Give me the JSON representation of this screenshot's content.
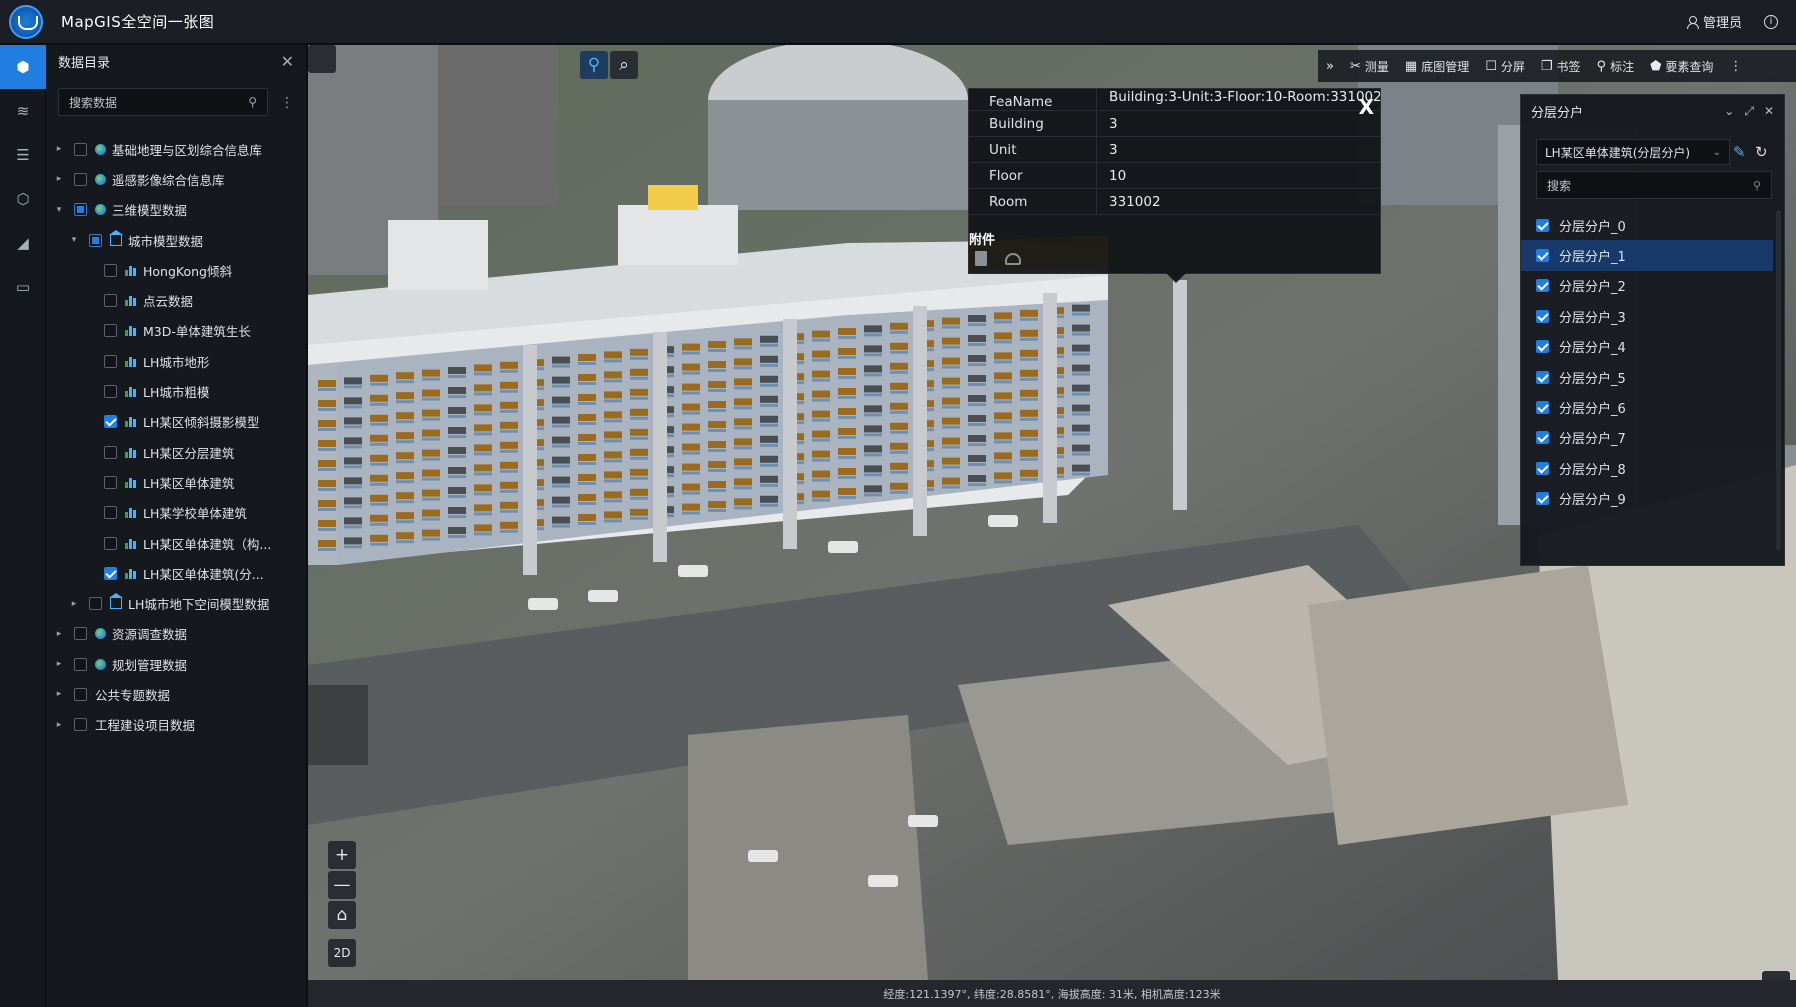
{
  "app": {
    "title": "MapGIS全空间一张图",
    "user": "管理员"
  },
  "leftbar": {
    "items": [
      "cube-icon",
      "layers-icon",
      "list-icon",
      "shield-icon",
      "draw-icon",
      "screen-icon"
    ]
  },
  "catalog": {
    "title": "数据目录",
    "search_placeholder": "搜索数据",
    "nodes": [
      {
        "label": "基础地理与区划综合信息库",
        "arrow": "▸",
        "check": "none",
        "icon": "globe"
      },
      {
        "label": "遥感影像综合信息库",
        "arrow": "▸",
        "check": "none",
        "icon": "globe"
      },
      {
        "label": "三维模型数据",
        "arrow": "▾",
        "check": "partial",
        "icon": "globe"
      },
      {
        "label": "城市模型数据",
        "arrow": "▾",
        "check": "partial",
        "icon": "house"
      },
      {
        "label": "HongKong倾斜",
        "arrow": "",
        "check": "none",
        "icon": "bars"
      },
      {
        "label": "点云数据",
        "arrow": "",
        "check": "none",
        "icon": "bars"
      },
      {
        "label": "M3D-单体建筑生长",
        "arrow": "",
        "check": "none",
        "icon": "bars"
      },
      {
        "label": "LH城市地形",
        "arrow": "",
        "check": "none",
        "icon": "bars"
      },
      {
        "label": "LH城市粗模",
        "arrow": "",
        "check": "none",
        "icon": "bars"
      },
      {
        "label": "LH某区倾斜摄影模型",
        "arrow": "",
        "check": "checked",
        "icon": "bars"
      },
      {
        "label": "LH某区分层建筑",
        "arrow": "",
        "check": "none",
        "icon": "bars"
      },
      {
        "label": "LH某区单体建筑",
        "arrow": "",
        "check": "none",
        "icon": "bars"
      },
      {
        "label": "LH某学校单体建筑",
        "arrow": "",
        "check": "none",
        "icon": "bars"
      },
      {
        "label": "LH某区单体建筑（构...",
        "arrow": "",
        "check": "none",
        "icon": "bars"
      },
      {
        "label": "LH某区单体建筑(分...",
        "arrow": "",
        "check": "checked",
        "icon": "bars"
      },
      {
        "label": "LH城市地下空间模型数据",
        "arrow": "▸",
        "check": "none",
        "icon": "house"
      },
      {
        "label": "资源调查数据",
        "arrow": "▸",
        "check": "none",
        "icon": "globe"
      },
      {
        "label": "规划管理数据",
        "arrow": "▸",
        "check": "none",
        "icon": "globe"
      },
      {
        "label": "公共专题数据",
        "arrow": "▸",
        "check": "none",
        "icon": ""
      },
      {
        "label": "工程建设项目数据",
        "arrow": "▸",
        "check": "none",
        "icon": ""
      }
    ]
  },
  "toolbar": {
    "items": [
      {
        "icon": "»",
        "label": ""
      },
      {
        "icon": "✂",
        "label": "测量"
      },
      {
        "icon": "▦",
        "label": "底图管理"
      },
      {
        "icon": "☐",
        "label": "分屏"
      },
      {
        "icon": "❐",
        "label": "书签"
      },
      {
        "icon": "⚲",
        "label": "标注"
      },
      {
        "icon": "⬟",
        "label": "要素查询"
      },
      {
        "icon": "⋮",
        "label": ""
      }
    ]
  },
  "popup": {
    "rows": [
      {
        "key": "FeaName",
        "value": "Building:3-Unit:3-Floor:10-Room:331002"
      },
      {
        "key": "Building",
        "value": "3"
      },
      {
        "key": "Unit",
        "value": "3"
      },
      {
        "key": "Floor",
        "value": "10"
      },
      {
        "key": "Room",
        "value": "331002"
      }
    ],
    "attach_label": "附件",
    "close_label": "X"
  },
  "layerpanel": {
    "title": "分层分户",
    "select_value": "LH某区单体建筑(分层分户)",
    "search_placeholder": "搜索",
    "items": [
      "分层分户_0",
      "分层分户_1",
      "分层分户_2",
      "分层分户_3",
      "分层分户_4",
      "分层分户_5",
      "分层分户_6",
      "分层分户_7",
      "分层分户_8",
      "分层分户_9"
    ],
    "selected_index": 1
  },
  "map_controls": {
    "zoom_in": "+",
    "zoom_out": "—",
    "home": "⌂",
    "mode": "2D"
  },
  "status": {
    "text": "经度:121.1397°, 纬度:28.8581°, 海拔高度: 31米, 相机高度:123米"
  },
  "colors": {
    "accent": "#1f7ee0",
    "highlight": "#f2d21a",
    "panel": "#15181d"
  }
}
